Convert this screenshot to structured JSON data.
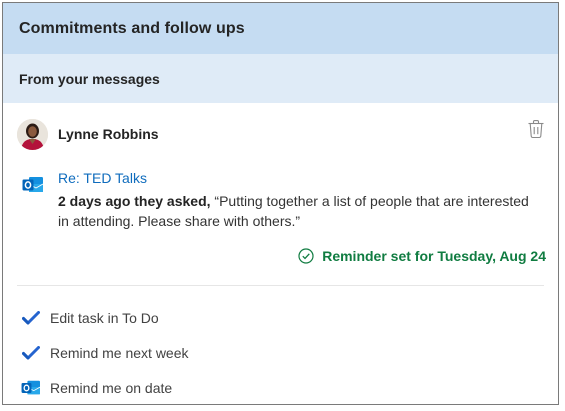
{
  "header": {
    "title": "Commitments and follow ups"
  },
  "section": {
    "title": "From your messages"
  },
  "person": {
    "name": "Lynne Robbins"
  },
  "message": {
    "subject": "Re: TED Talks",
    "time_prefix": "2 days ago they asked,",
    "quote": " “Putting together a list of people that are interested in attending. Please share with others.”"
  },
  "reminder": {
    "text": "Reminder set for Tuesday, Aug 24"
  },
  "actions": [
    {
      "label": "Edit task in To Do",
      "icon": "todo-check-icon"
    },
    {
      "label": "Remind me next week",
      "icon": "todo-check-icon"
    },
    {
      "label": "Remind me on date",
      "icon": "outlook-icon"
    }
  ],
  "colors": {
    "header_bg": "#c5dcf2",
    "subheader_bg": "#dfebf7",
    "link": "#0f6cbd",
    "success": "#107c41",
    "todo_blue": "#2564cf"
  }
}
